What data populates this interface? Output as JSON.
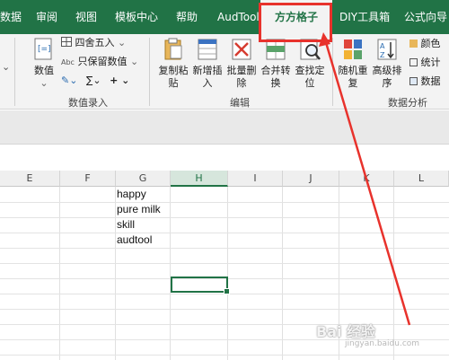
{
  "tabs": [
    {
      "label": "数据"
    },
    {
      "label": "审阅"
    },
    {
      "label": "视图"
    },
    {
      "label": "模板中心"
    },
    {
      "label": "帮助"
    },
    {
      "label": "AudTool"
    },
    {
      "label": "方方格子"
    },
    {
      "label": "DIY工具箱"
    },
    {
      "label": "公式向导"
    }
  ],
  "active_tab": "方方格子",
  "ribbon": {
    "numeric_group": {
      "value_button": "数值",
      "round_option": "四舍五入",
      "keep_values_option": "只保留数值",
      "label": "数值录入"
    },
    "edit_group": {
      "copy_paste": {
        "line1": "复制粘",
        "line2": "贴"
      },
      "insert_new": {
        "line1": "新增插",
        "line2": "入"
      },
      "batch_delete": {
        "line1": "批量删",
        "line2": "除"
      },
      "merge_convert": {
        "line1": "合并转",
        "line2": "换"
      },
      "find_locate": {
        "line1": "查找定",
        "line2": "位"
      },
      "label": "编辑"
    },
    "analysis_group": {
      "random_repeat": {
        "line1": "随机重",
        "line2": "复"
      },
      "advanced_sort": {
        "line1": "高级排",
        "line2": "序"
      },
      "color": "颜色",
      "stats": "统计",
      "data": "数据",
      "label": "数据分析"
    }
  },
  "columns": [
    "E",
    "F",
    "G",
    "H",
    "I",
    "J",
    "K",
    "L"
  ],
  "selected_column": "H",
  "cells": [
    "happy",
    "pure milk",
    "skill",
    "audtool"
  ],
  "watermark": {
    "main": "Bai 经验",
    "sub": "jingyan.baidu.com"
  },
  "colors": {
    "accent": "#217346",
    "annotation": "#e8322c"
  }
}
